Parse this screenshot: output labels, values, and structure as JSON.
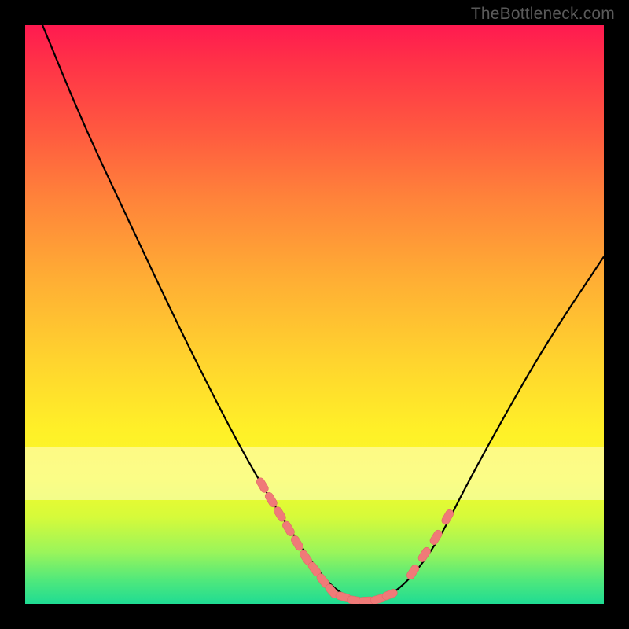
{
  "watermark": "TheBottleneck.com",
  "colors": {
    "page_bg": "#000000",
    "gradient_top": "#ff1a50",
    "gradient_bottom": "#1fdc93",
    "watermark_text": "#5a5a5a",
    "curve_stroke": "#000000",
    "marker_fill": "#f07a78",
    "marker_stroke": "#e06a68"
  },
  "chart_data": {
    "type": "line",
    "title": "",
    "xlabel": "",
    "ylabel": "",
    "xlim": [
      0,
      100
    ],
    "ylim": [
      0,
      100
    ],
    "grid": false,
    "legend": false,
    "series": [
      {
        "name": "curve",
        "x": [
          3,
          10,
          18,
          26,
          34,
          40,
          45,
          49,
          52,
          55,
          58,
          61,
          64,
          68,
          72,
          76,
          82,
          90,
          100
        ],
        "y": [
          100,
          83,
          66,
          49,
          33,
          22,
          14,
          8,
          4,
          1.5,
          0.4,
          0.7,
          2,
          6,
          12,
          20,
          31,
          45,
          60
        ]
      }
    ],
    "markers": [
      {
        "name": "left-dash-group",
        "x": [
          41.0,
          42.5,
          44.0,
          45.5,
          47.0,
          48.5,
          50.0,
          51.5,
          53.0
        ],
        "y": [
          20.5,
          18.0,
          15.5,
          13.0,
          10.5,
          8.0,
          6.0,
          4.0,
          2.2
        ]
      },
      {
        "name": "bottom-group",
        "x": [
          55.0,
          57.0,
          59.0,
          61.0,
          63.0
        ],
        "y": [
          1.2,
          0.6,
          0.5,
          0.8,
          1.6
        ]
      },
      {
        "name": "right-dash-group",
        "x": [
          67.0,
          69.0,
          71.0,
          73.0
        ],
        "y": [
          5.5,
          8.5,
          11.5,
          15.0
        ]
      }
    ],
    "annotations": []
  }
}
